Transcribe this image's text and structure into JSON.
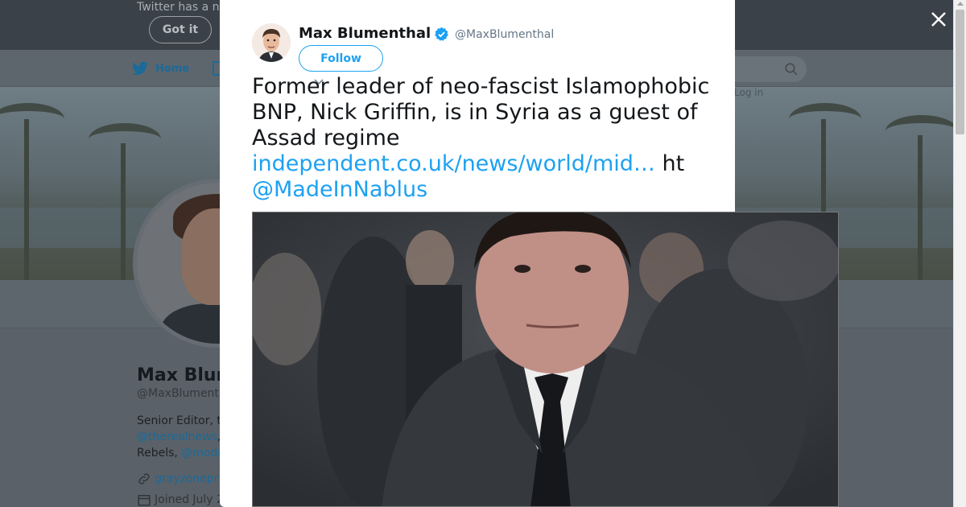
{
  "notice": {
    "text": "Twitter has a n",
    "got_it_label": "Got it"
  },
  "nav": {
    "home_label": "Home",
    "login_text": "Log in"
  },
  "profile": {
    "name": "Max Blum",
    "handle": "@MaxBlument",
    "bio_line1": "Senior Editor, t",
    "bio_link1": "@therealnews",
    "bio_line2_after": ",",
    "bio_line3": "Rebels, ",
    "bio_link2": "@mode",
    "website": "grayzonepr",
    "joined": "Joined July 2"
  },
  "tweet": {
    "author_name": "Max Blumenthal",
    "author_handle": "@MaxBlumenthal",
    "verified": true,
    "follow_label": "Follow",
    "text_before_link": "Former leader of neo-fascist Islamophobic BNP, Nick Griffin, is in Syria as a guest of Assad regime ",
    "link_text": "independent.co.uk/news/world/mid…",
    "text_after_link": " ht ",
    "mention": "@MadeInNablus"
  },
  "colors": {
    "link": "#1da1f2",
    "verified": "#1da1f2",
    "overlay": "#5a636b"
  },
  "icons": [
    "close-icon",
    "verified-badge-icon",
    "twitter-bird-icon",
    "search-icon",
    "link-icon",
    "calendar-icon",
    "chevron-down-icon"
  ]
}
